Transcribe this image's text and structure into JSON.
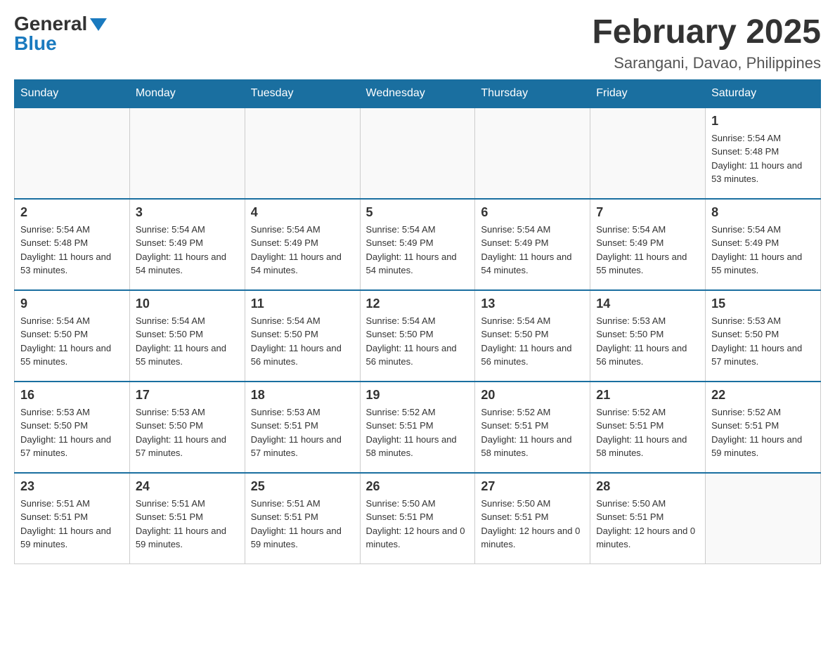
{
  "header": {
    "logo": {
      "general": "General",
      "blue": "Blue"
    },
    "title": "February 2025",
    "location": "Sarangani, Davao, Philippines"
  },
  "days_of_week": [
    "Sunday",
    "Monday",
    "Tuesday",
    "Wednesday",
    "Thursday",
    "Friday",
    "Saturday"
  ],
  "weeks": [
    [
      {
        "day": "",
        "sunrise": "",
        "sunset": "",
        "daylight": "",
        "empty": true
      },
      {
        "day": "",
        "sunrise": "",
        "sunset": "",
        "daylight": "",
        "empty": true
      },
      {
        "day": "",
        "sunrise": "",
        "sunset": "",
        "daylight": "",
        "empty": true
      },
      {
        "day": "",
        "sunrise": "",
        "sunset": "",
        "daylight": "",
        "empty": true
      },
      {
        "day": "",
        "sunrise": "",
        "sunset": "",
        "daylight": "",
        "empty": true
      },
      {
        "day": "",
        "sunrise": "",
        "sunset": "",
        "daylight": "",
        "empty": true
      },
      {
        "day": "1",
        "sunrise": "Sunrise: 5:54 AM",
        "sunset": "Sunset: 5:48 PM",
        "daylight": "Daylight: 11 hours and 53 minutes.",
        "empty": false
      }
    ],
    [
      {
        "day": "2",
        "sunrise": "Sunrise: 5:54 AM",
        "sunset": "Sunset: 5:48 PM",
        "daylight": "Daylight: 11 hours and 53 minutes.",
        "empty": false
      },
      {
        "day": "3",
        "sunrise": "Sunrise: 5:54 AM",
        "sunset": "Sunset: 5:49 PM",
        "daylight": "Daylight: 11 hours and 54 minutes.",
        "empty": false
      },
      {
        "day": "4",
        "sunrise": "Sunrise: 5:54 AM",
        "sunset": "Sunset: 5:49 PM",
        "daylight": "Daylight: 11 hours and 54 minutes.",
        "empty": false
      },
      {
        "day": "5",
        "sunrise": "Sunrise: 5:54 AM",
        "sunset": "Sunset: 5:49 PM",
        "daylight": "Daylight: 11 hours and 54 minutes.",
        "empty": false
      },
      {
        "day": "6",
        "sunrise": "Sunrise: 5:54 AM",
        "sunset": "Sunset: 5:49 PM",
        "daylight": "Daylight: 11 hours and 54 minutes.",
        "empty": false
      },
      {
        "day": "7",
        "sunrise": "Sunrise: 5:54 AM",
        "sunset": "Sunset: 5:49 PM",
        "daylight": "Daylight: 11 hours and 55 minutes.",
        "empty": false
      },
      {
        "day": "8",
        "sunrise": "Sunrise: 5:54 AM",
        "sunset": "Sunset: 5:49 PM",
        "daylight": "Daylight: 11 hours and 55 minutes.",
        "empty": false
      }
    ],
    [
      {
        "day": "9",
        "sunrise": "Sunrise: 5:54 AM",
        "sunset": "Sunset: 5:50 PM",
        "daylight": "Daylight: 11 hours and 55 minutes.",
        "empty": false
      },
      {
        "day": "10",
        "sunrise": "Sunrise: 5:54 AM",
        "sunset": "Sunset: 5:50 PM",
        "daylight": "Daylight: 11 hours and 55 minutes.",
        "empty": false
      },
      {
        "day": "11",
        "sunrise": "Sunrise: 5:54 AM",
        "sunset": "Sunset: 5:50 PM",
        "daylight": "Daylight: 11 hours and 56 minutes.",
        "empty": false
      },
      {
        "day": "12",
        "sunrise": "Sunrise: 5:54 AM",
        "sunset": "Sunset: 5:50 PM",
        "daylight": "Daylight: 11 hours and 56 minutes.",
        "empty": false
      },
      {
        "day": "13",
        "sunrise": "Sunrise: 5:54 AM",
        "sunset": "Sunset: 5:50 PM",
        "daylight": "Daylight: 11 hours and 56 minutes.",
        "empty": false
      },
      {
        "day": "14",
        "sunrise": "Sunrise: 5:53 AM",
        "sunset": "Sunset: 5:50 PM",
        "daylight": "Daylight: 11 hours and 56 minutes.",
        "empty": false
      },
      {
        "day": "15",
        "sunrise": "Sunrise: 5:53 AM",
        "sunset": "Sunset: 5:50 PM",
        "daylight": "Daylight: 11 hours and 57 minutes.",
        "empty": false
      }
    ],
    [
      {
        "day": "16",
        "sunrise": "Sunrise: 5:53 AM",
        "sunset": "Sunset: 5:50 PM",
        "daylight": "Daylight: 11 hours and 57 minutes.",
        "empty": false
      },
      {
        "day": "17",
        "sunrise": "Sunrise: 5:53 AM",
        "sunset": "Sunset: 5:50 PM",
        "daylight": "Daylight: 11 hours and 57 minutes.",
        "empty": false
      },
      {
        "day": "18",
        "sunrise": "Sunrise: 5:53 AM",
        "sunset": "Sunset: 5:51 PM",
        "daylight": "Daylight: 11 hours and 57 minutes.",
        "empty": false
      },
      {
        "day": "19",
        "sunrise": "Sunrise: 5:52 AM",
        "sunset": "Sunset: 5:51 PM",
        "daylight": "Daylight: 11 hours and 58 minutes.",
        "empty": false
      },
      {
        "day": "20",
        "sunrise": "Sunrise: 5:52 AM",
        "sunset": "Sunset: 5:51 PM",
        "daylight": "Daylight: 11 hours and 58 minutes.",
        "empty": false
      },
      {
        "day": "21",
        "sunrise": "Sunrise: 5:52 AM",
        "sunset": "Sunset: 5:51 PM",
        "daylight": "Daylight: 11 hours and 58 minutes.",
        "empty": false
      },
      {
        "day": "22",
        "sunrise": "Sunrise: 5:52 AM",
        "sunset": "Sunset: 5:51 PM",
        "daylight": "Daylight: 11 hours and 59 minutes.",
        "empty": false
      }
    ],
    [
      {
        "day": "23",
        "sunrise": "Sunrise: 5:51 AM",
        "sunset": "Sunset: 5:51 PM",
        "daylight": "Daylight: 11 hours and 59 minutes.",
        "empty": false
      },
      {
        "day": "24",
        "sunrise": "Sunrise: 5:51 AM",
        "sunset": "Sunset: 5:51 PM",
        "daylight": "Daylight: 11 hours and 59 minutes.",
        "empty": false
      },
      {
        "day": "25",
        "sunrise": "Sunrise: 5:51 AM",
        "sunset": "Sunset: 5:51 PM",
        "daylight": "Daylight: 11 hours and 59 minutes.",
        "empty": false
      },
      {
        "day": "26",
        "sunrise": "Sunrise: 5:50 AM",
        "sunset": "Sunset: 5:51 PM",
        "daylight": "Daylight: 12 hours and 0 minutes.",
        "empty": false
      },
      {
        "day": "27",
        "sunrise": "Sunrise: 5:50 AM",
        "sunset": "Sunset: 5:51 PM",
        "daylight": "Daylight: 12 hours and 0 minutes.",
        "empty": false
      },
      {
        "day": "28",
        "sunrise": "Sunrise: 5:50 AM",
        "sunset": "Sunset: 5:51 PM",
        "daylight": "Daylight: 12 hours and 0 minutes.",
        "empty": false
      },
      {
        "day": "",
        "sunrise": "",
        "sunset": "",
        "daylight": "",
        "empty": true
      }
    ]
  ]
}
